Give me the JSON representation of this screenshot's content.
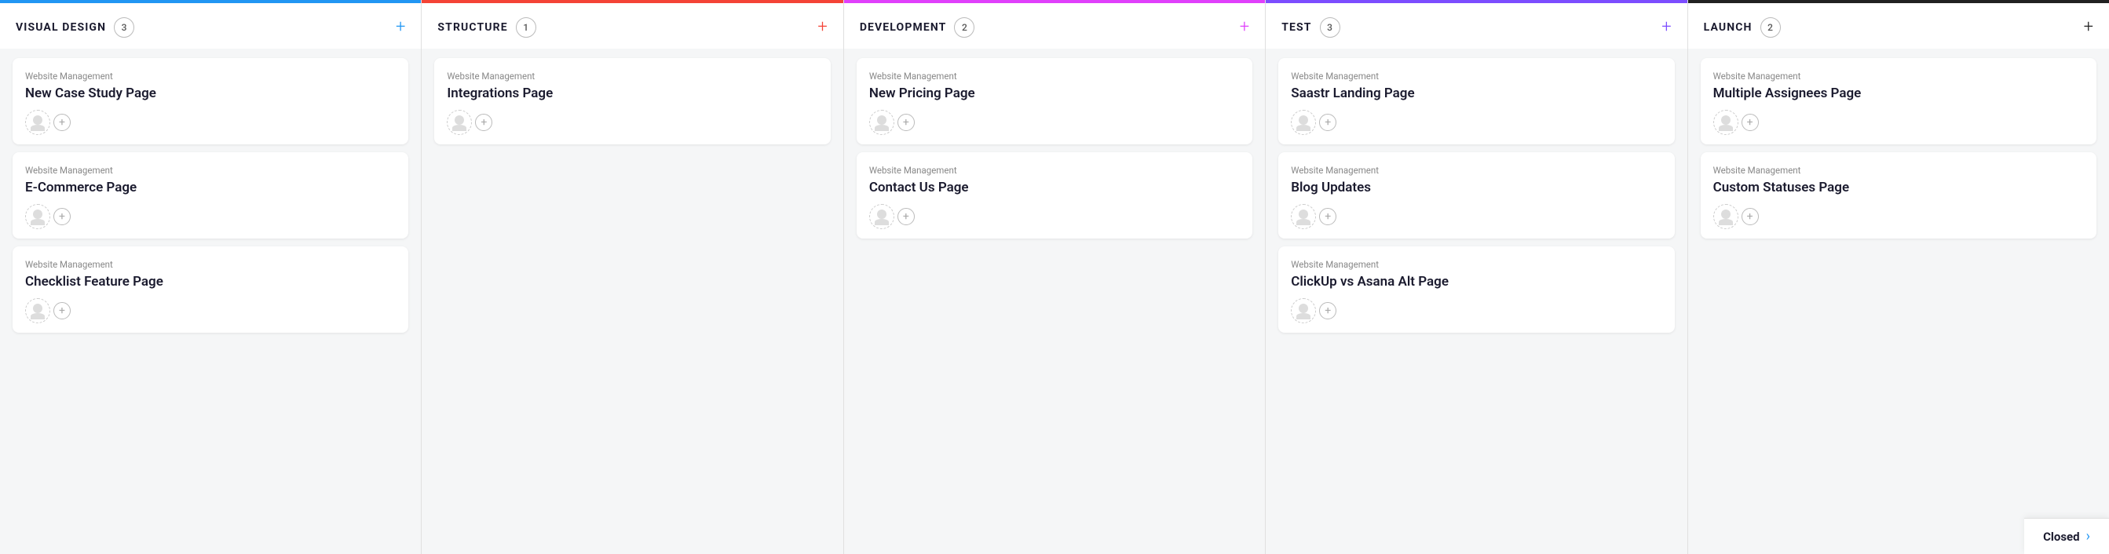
{
  "columns": [
    {
      "id": "visual-design",
      "title": "VISUAL DESIGN",
      "count": 3,
      "color": "#2196f3",
      "add_label": "+",
      "cards": [
        {
          "project": "Website Management",
          "title": "New Case Study Page"
        },
        {
          "project": "Website Management",
          "title": "E-Commerce Page"
        },
        {
          "project": "Website Management",
          "title": "Checklist Feature Page"
        }
      ]
    },
    {
      "id": "structure",
      "title": "STRUCTURE",
      "count": 1,
      "color": "#f44336",
      "add_label": "+",
      "cards": [
        {
          "project": "Website Management",
          "title": "Integrations Page"
        }
      ]
    },
    {
      "id": "development",
      "title": "DEVELOPMENT",
      "count": 2,
      "color": "#e040fb",
      "add_label": "+",
      "cards": [
        {
          "project": "Website Management",
          "title": "New Pricing Page"
        },
        {
          "project": "Website Management",
          "title": "Contact Us Page"
        }
      ]
    },
    {
      "id": "test",
      "title": "TEST",
      "count": 3,
      "color": "#7c4dff",
      "add_label": "+",
      "cards": [
        {
          "project": "Website Management",
          "title": "Saastr Landing Page"
        },
        {
          "project": "Website Management",
          "title": "Blog Updates"
        },
        {
          "project": "Website Management",
          "title": "ClickUp vs Asana Alt Page"
        }
      ]
    },
    {
      "id": "launch",
      "title": "LAUNCH",
      "count": 2,
      "color": "#212121",
      "add_label": "+",
      "cards": [
        {
          "project": "Website Management",
          "title": "Multiple Assignees Page"
        },
        {
          "project": "Website Management",
          "title": "Custom Statuses Page"
        }
      ]
    }
  ],
  "closed": {
    "label": "Closed",
    "arrow": "›"
  }
}
